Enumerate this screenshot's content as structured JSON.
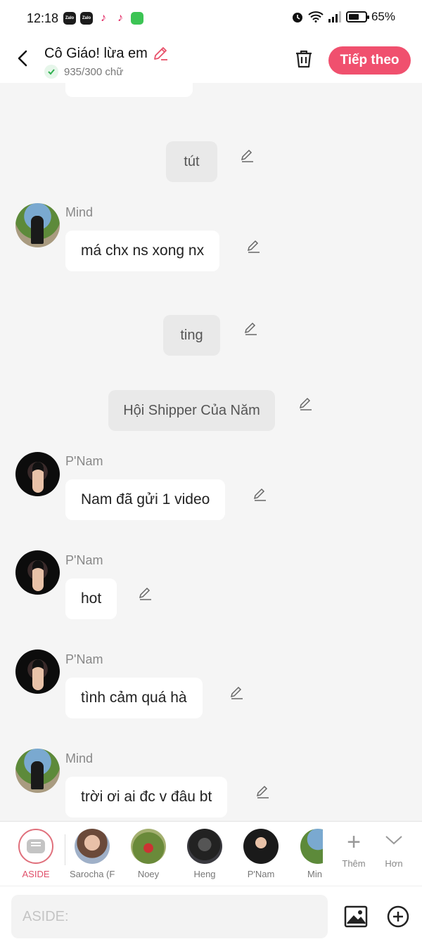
{
  "status_bar": {
    "time": "12:18",
    "battery": "65%",
    "battery_level": 0.65,
    "apps": [
      "Zalo",
      "Zalo"
    ]
  },
  "header": {
    "title": "Cô Giáo! lừa em",
    "word_count": "935/300 chữ",
    "next_label": "Tiếp theo"
  },
  "messages": [
    {
      "type": "narration",
      "text": "tút"
    },
    {
      "type": "message",
      "sender": "Mind",
      "text": "má chx ns xong nx"
    },
    {
      "type": "narration",
      "text": "ting"
    },
    {
      "type": "narration",
      "text": "Hội Shipper Của Năm"
    },
    {
      "type": "message",
      "sender": "P'Nam",
      "text": "Nam đã gửi 1 video"
    },
    {
      "type": "message",
      "sender": "P'Nam",
      "text": "hot"
    },
    {
      "type": "message",
      "sender": "P'Nam",
      "text": "tình cảm quá hà"
    },
    {
      "type": "message",
      "sender": "Mind",
      "text": "trời ơi ai đc v đâu bt"
    }
  ],
  "characters": [
    {
      "name": "ASIDE",
      "selected": true
    },
    {
      "name": "Sarocha (F..."
    },
    {
      "name": "Noey"
    },
    {
      "name": "Heng"
    },
    {
      "name": "P'Nam"
    },
    {
      "name": "Min"
    }
  ],
  "strip_actions": {
    "add_label": "Thêm",
    "more_label": "Hơn"
  },
  "input": {
    "placeholder": "ASIDE:"
  }
}
